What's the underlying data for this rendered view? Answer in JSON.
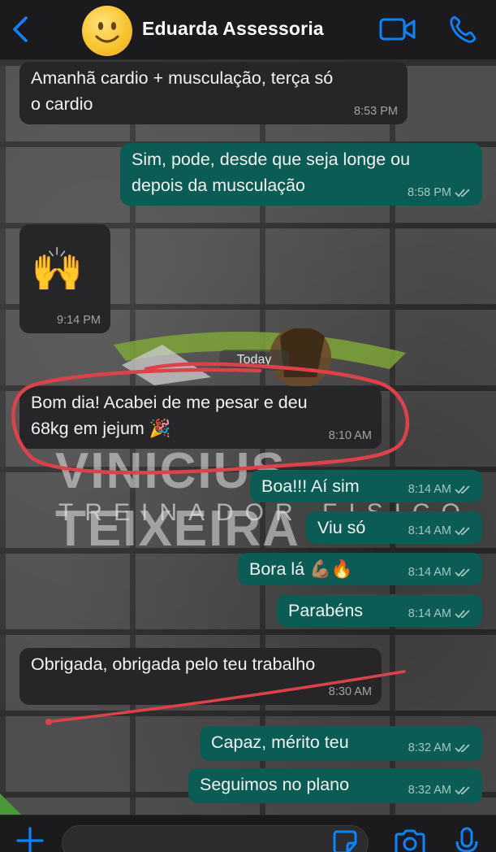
{
  "header": {
    "contact_name": "Eduarda Assessoria"
  },
  "watermark": {
    "line1": "VINICIUS TEIXEIRA",
    "line2": "TREINADOR FÍSICO"
  },
  "date_separator": "Today",
  "messages": [
    {
      "direction": "in",
      "text_lines": [
        "Amanhã cardio + musculação, terça só",
        "o cardio"
      ],
      "time": "8:53 PM"
    },
    {
      "direction": "out",
      "text_lines": [
        "Sim, pode, desde que seja longe ou",
        "depois da musculação"
      ],
      "time": "8:58 PM",
      "status": "read"
    },
    {
      "direction": "in",
      "emoji": "🙌",
      "time": "9:14 PM"
    },
    {
      "direction": "in",
      "text_lines": [
        "Bom dia! Acabei de me pesar e deu",
        "68kg em jejum 🎉"
      ],
      "time": "8:10 AM",
      "highlighted": true
    },
    {
      "direction": "out",
      "text": "Boa!!! Aí sim",
      "time": "8:14 AM",
      "status": "read"
    },
    {
      "direction": "out",
      "text": "Viu só",
      "time": "8:14 AM",
      "status": "read"
    },
    {
      "direction": "out",
      "text": "Bora lá 💪🏽🔥",
      "time": "8:14 AM",
      "status": "read"
    },
    {
      "direction": "out",
      "text": "Parabéns",
      "time": "8:14 AM",
      "status": "read"
    },
    {
      "direction": "in",
      "text": "Obrigada, obrigada pelo teu trabalho",
      "time": "8:30 AM",
      "underlined": true
    },
    {
      "direction": "out",
      "text": "Capaz, mérito teu",
      "time": "8:32 AM",
      "status": "read"
    },
    {
      "direction": "out",
      "text": "Seguimos no plano",
      "time": "8:32 AM",
      "status": "read"
    }
  ],
  "icons": {
    "back": "chevron-left-icon",
    "video": "video-camera-icon",
    "call": "phone-icon",
    "attach": "plus-icon",
    "sticker": "sticker-icon",
    "camera": "camera-icon",
    "mic": "microphone-icon"
  },
  "colors": {
    "accent": "#0a84ff",
    "outgoing_bubble": "#0b5c55",
    "incoming_bubble": "#262628",
    "annotation_red": "#e0404a"
  }
}
